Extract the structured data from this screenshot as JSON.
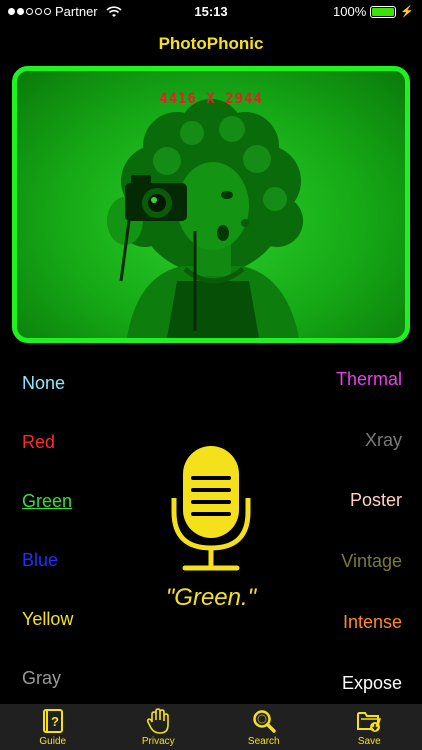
{
  "status_bar": {
    "carrier": "Partner",
    "time": "15:13",
    "battery": "100%"
  },
  "nav": {
    "title": "PhotoPhonic"
  },
  "photo": {
    "dimensions": "4416  X  2944",
    "frame_color": "#1ff21f"
  },
  "filters_left": [
    {
      "label": "None",
      "color": "#8fe7ff"
    },
    {
      "label": "Red",
      "color": "#ff2a2a"
    },
    {
      "label": "Green",
      "color": "#35e035",
      "selected": true
    },
    {
      "label": "Blue",
      "color": "#2030ff"
    },
    {
      "label": "Yellow",
      "color": "#f5e11b"
    },
    {
      "label": "Gray",
      "color": "#9a9a9a"
    }
  ],
  "filters_right": [
    {
      "label": "Thermal",
      "color": "#e840e8"
    },
    {
      "label": "Xray",
      "color": "#7a7a7a"
    },
    {
      "label": "Poster",
      "color": "#ffd2c2"
    },
    {
      "label": "Vintage",
      "color": "#7a7a3a"
    },
    {
      "label": "Intense",
      "color": "#ff8a2a"
    },
    {
      "label": "Expose",
      "color": "#ffffff"
    }
  ],
  "voice": {
    "icon": "microphone-icon",
    "recognized_text": "\"Green.\""
  },
  "tab_bar": {
    "accent": "#f5e11b",
    "tabs": [
      {
        "label": "Guide",
        "icon": "book-question-icon"
      },
      {
        "label": "Privacy",
        "icon": "hand-icon"
      },
      {
        "label": "Search",
        "icon": "magnifier-icon"
      },
      {
        "label": "Save",
        "icon": "folder-save-icon"
      }
    ]
  }
}
